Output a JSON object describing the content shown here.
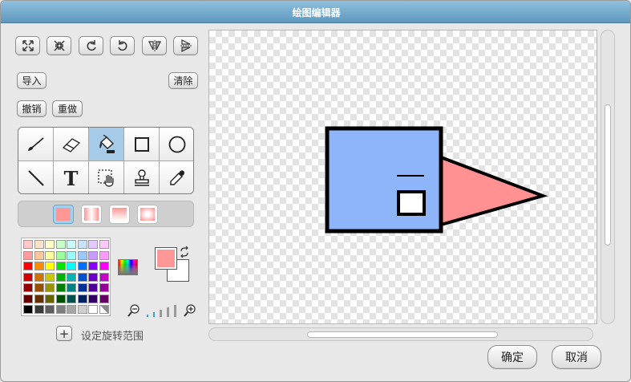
{
  "window": {
    "title": "绘图编辑器"
  },
  "toolbar": {
    "top_icons": [
      "grow-icon",
      "shrink-icon",
      "rotate-left-icon",
      "rotate-right-icon",
      "flip-horizontal-icon",
      "flip-vertical-icon"
    ],
    "import_label": "导入",
    "clear_label": "清除",
    "undo_label": "撤销",
    "redo_label": "重做"
  },
  "tools": {
    "items": [
      "brush-icon",
      "eraser-icon",
      "fill-icon",
      "rectangle-icon",
      "ellipse-icon",
      "line-icon",
      "text-icon",
      "select-icon",
      "stamp-icon",
      "eyedropper-icon"
    ],
    "selected": "fill-icon",
    "text_glyph": "T"
  },
  "fill_options": {
    "selected_index": 0,
    "color": "#ff9797"
  },
  "palette": {
    "rows": [
      [
        "#ffc9c9",
        "#ffe3c9",
        "#ffffc9",
        "#c9ffc9",
        "#c9ffff",
        "#c9e3ff",
        "#e3c9ff",
        "#ffc9ff"
      ],
      [
        "#ff9b9b",
        "#ffc89b",
        "#ffff9b",
        "#9bff9b",
        "#9bffff",
        "#9bc8ff",
        "#c89bff",
        "#ff9bff"
      ],
      [
        "#ff0000",
        "#ff8a00",
        "#ffff00",
        "#00e600",
        "#00ffff",
        "#0070ff",
        "#8a00ff",
        "#ff00ff"
      ],
      [
        "#d30000",
        "#d47000",
        "#c8c800",
        "#00b400",
        "#00b4b4",
        "#0050d2",
        "#6a00c8",
        "#c800c8"
      ],
      [
        "#960000",
        "#965000",
        "#969600",
        "#008200",
        "#008282",
        "#003296",
        "#500096",
        "#960096"
      ],
      [
        "#640000",
        "#643200",
        "#646400",
        "#005000",
        "#005050",
        "#002064",
        "#320064",
        "#640064"
      ],
      [
        "#000000",
        "#3a3a3a",
        "#5e5e5e",
        "#7f7f7f",
        "#a6a6a6",
        "#cecece",
        "#ffffff",
        "#ffffff"
      ]
    ]
  },
  "colors": {
    "foreground": "#ff9797",
    "background": "#ffffff"
  },
  "rotation": {
    "label": "设定旋转范围"
  },
  "drawing": {
    "body_color": "#8eb5fa",
    "nose_color": "#ff9193",
    "outline": "#000000"
  },
  "buttons": {
    "ok_label": "确定",
    "cancel_label": "取消"
  }
}
